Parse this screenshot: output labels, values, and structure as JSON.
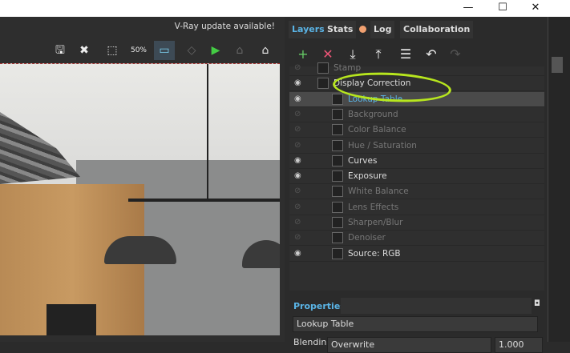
{
  "window": {
    "minimize": "—",
    "maximize": "☐",
    "close": "✕"
  },
  "notice": "V-Ray update available!",
  "toolbar": [
    {
      "icon": "save-icon",
      "glyph": "🖫"
    },
    {
      "icon": "clear-icon",
      "glyph": "✖"
    },
    {
      "icon": "region-select-icon",
      "glyph": "⬚"
    },
    {
      "icon": "zoom-50-icon",
      "glyph": "50%"
    },
    {
      "icon": "frame-icon",
      "glyph": "▭"
    },
    {
      "icon": "render-region-icon",
      "glyph": "◇"
    },
    {
      "icon": "render-teapot-icon",
      "glyph": "▶"
    },
    {
      "icon": "interactive-teapot-icon",
      "glyph": "⌂"
    },
    {
      "icon": "teapot-icon",
      "glyph": "⌂"
    }
  ],
  "tabs": [
    "Layers",
    "Stats",
    "Log",
    "Collaboration"
  ],
  "log_dot_color": "#f0a070",
  "accent": "#5ab4e6",
  "highlight_color": "#b7e61e",
  "layer_toolbar": [
    {
      "icon": "add-layer-icon",
      "glyph": "+"
    },
    {
      "icon": "delete-layer-icon",
      "glyph": "✕"
    },
    {
      "icon": "save-layers-icon",
      "glyph": "⤓"
    },
    {
      "icon": "load-layers-icon",
      "glyph": "⤒"
    },
    {
      "icon": "list-icon",
      "glyph": "☰"
    },
    {
      "icon": "undo-icon",
      "glyph": "↶"
    },
    {
      "icon": "redo-icon",
      "glyph": "↷"
    }
  ],
  "layers": [
    {
      "label": "Stamp",
      "enabled": false,
      "indent": 0
    },
    {
      "label": "Display Correction",
      "enabled": true,
      "indent": 0
    },
    {
      "label": "Lookup Table",
      "enabled": true,
      "indent": 1,
      "selected": true
    },
    {
      "label": "Background",
      "enabled": false,
      "indent": 1
    },
    {
      "label": "Color Balance",
      "enabled": false,
      "indent": 1
    },
    {
      "label": "Hue / Saturation",
      "enabled": false,
      "indent": 1
    },
    {
      "label": "Curves",
      "enabled": true,
      "indent": 1
    },
    {
      "label": "Exposure",
      "enabled": true,
      "indent": 1
    },
    {
      "label": "White Balance",
      "enabled": false,
      "indent": 1
    },
    {
      "label": "Lens Effects",
      "enabled": false,
      "indent": 1
    },
    {
      "label": "Sharpen/Blur",
      "enabled": false,
      "indent": 1
    },
    {
      "label": "Denoiser",
      "enabled": false,
      "indent": 1
    },
    {
      "label": "Source: RGB",
      "enabled": true,
      "indent": 1
    }
  ],
  "properties": {
    "title": "Properties",
    "name": "Lookup Table",
    "blending_label": "Blending",
    "blending_value": "Overwrite",
    "opacity": "1.000"
  }
}
